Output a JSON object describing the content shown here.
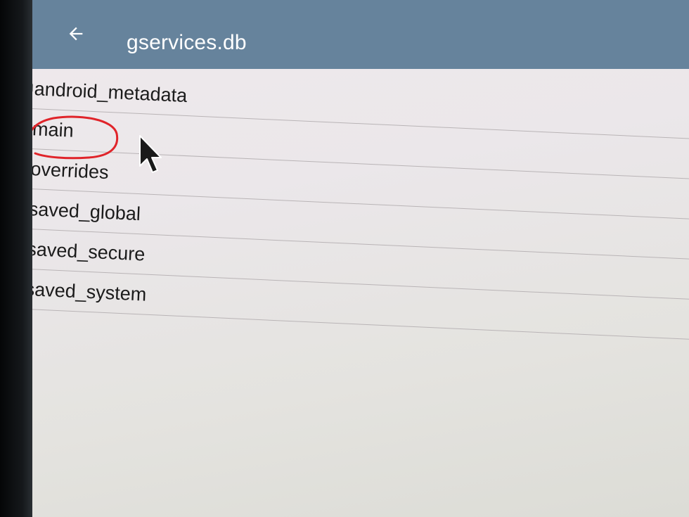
{
  "app_bar": {
    "title": "gservices.db",
    "back_icon": "arrow-left-icon",
    "color": "#66839c"
  },
  "tables": [
    {
      "name": "android_metadata"
    },
    {
      "name": "main",
      "annotated": true
    },
    {
      "name": "overrides"
    },
    {
      "name": "saved_global"
    },
    {
      "name": "saved_secure"
    },
    {
      "name": "saved_system"
    }
  ],
  "annotation": {
    "type": "red-circle",
    "color": "#e0242a",
    "target": "main"
  },
  "cursor": {
    "icon": "mouse-pointer-icon"
  }
}
